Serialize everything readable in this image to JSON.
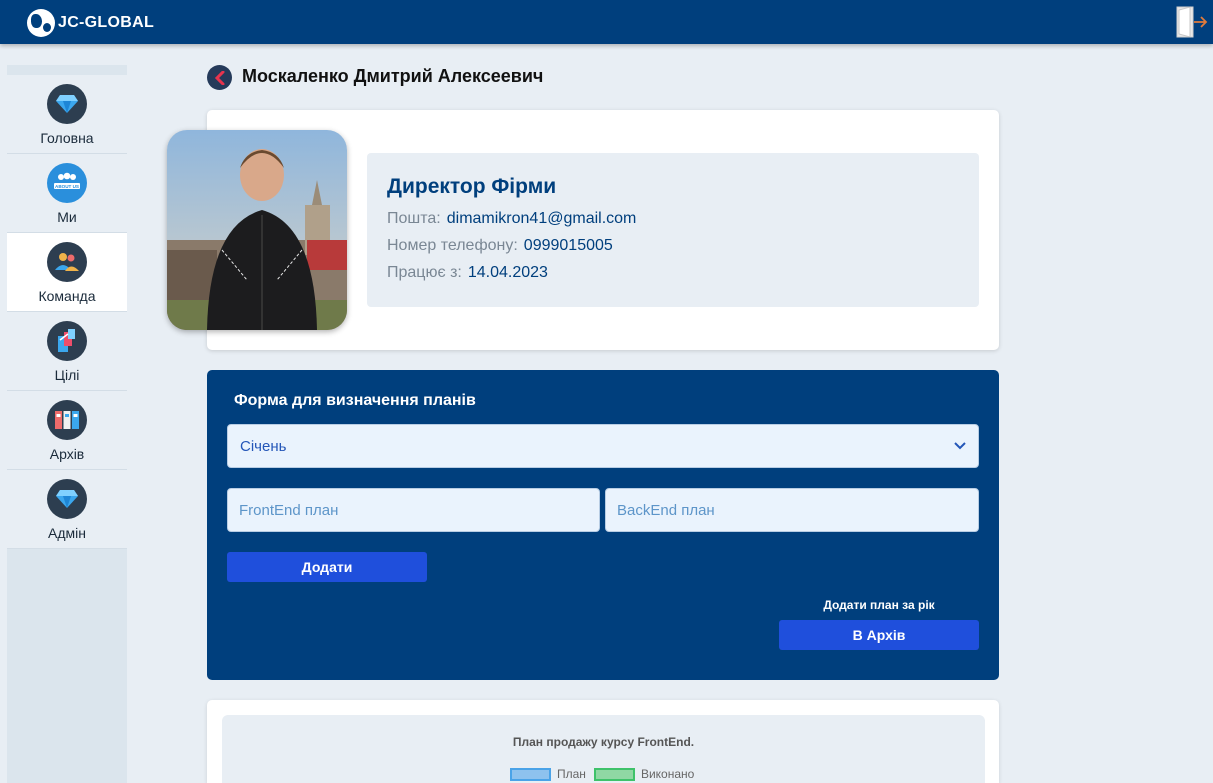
{
  "app": {
    "brand": "JC-GLOBAL"
  },
  "sidebar": {
    "items": [
      {
        "label": "Головна",
        "icon": "diamond-icon",
        "active": false
      },
      {
        "label": "Ми",
        "icon": "about-us-icon",
        "active": false
      },
      {
        "label": "Команда",
        "icon": "team-icon",
        "active": true
      },
      {
        "label": "Цілі",
        "icon": "goals-icon",
        "active": false
      },
      {
        "label": "Архів",
        "icon": "archive-icon",
        "active": false
      },
      {
        "label": "Адмін",
        "icon": "diamond-icon",
        "active": false
      }
    ]
  },
  "page": {
    "title": "Москаленко Дмитрий Алексеевич"
  },
  "profile": {
    "role": "Директор Фірми",
    "email_label": "Пошта:",
    "email": "dimamikron41@gmail.com",
    "phone_label": "Номер телефону:",
    "phone": "0999015005",
    "since_label": "Працює з:",
    "since": "14.04.2023"
  },
  "plan_form": {
    "title": "Форма для визначення планів",
    "month": "Січень",
    "frontend_placeholder": "FrontEnd план",
    "backend_placeholder": "BackEnd план",
    "add_button": "Додати",
    "year_label": "Додати план за рік",
    "archive_button": "В Архів"
  },
  "chart": {
    "title": "План продажу курсу FrontEnd.",
    "legend": [
      {
        "label": "План",
        "color": "#8ec2ee",
        "border": "#4aa3e8"
      },
      {
        "label": "Виконано",
        "color": "#8fd8a4",
        "border": "#3ec26a"
      }
    ]
  },
  "colors": {
    "primary": "#003f7d",
    "button": "#1f4fdc",
    "background": "#e8eef4"
  }
}
